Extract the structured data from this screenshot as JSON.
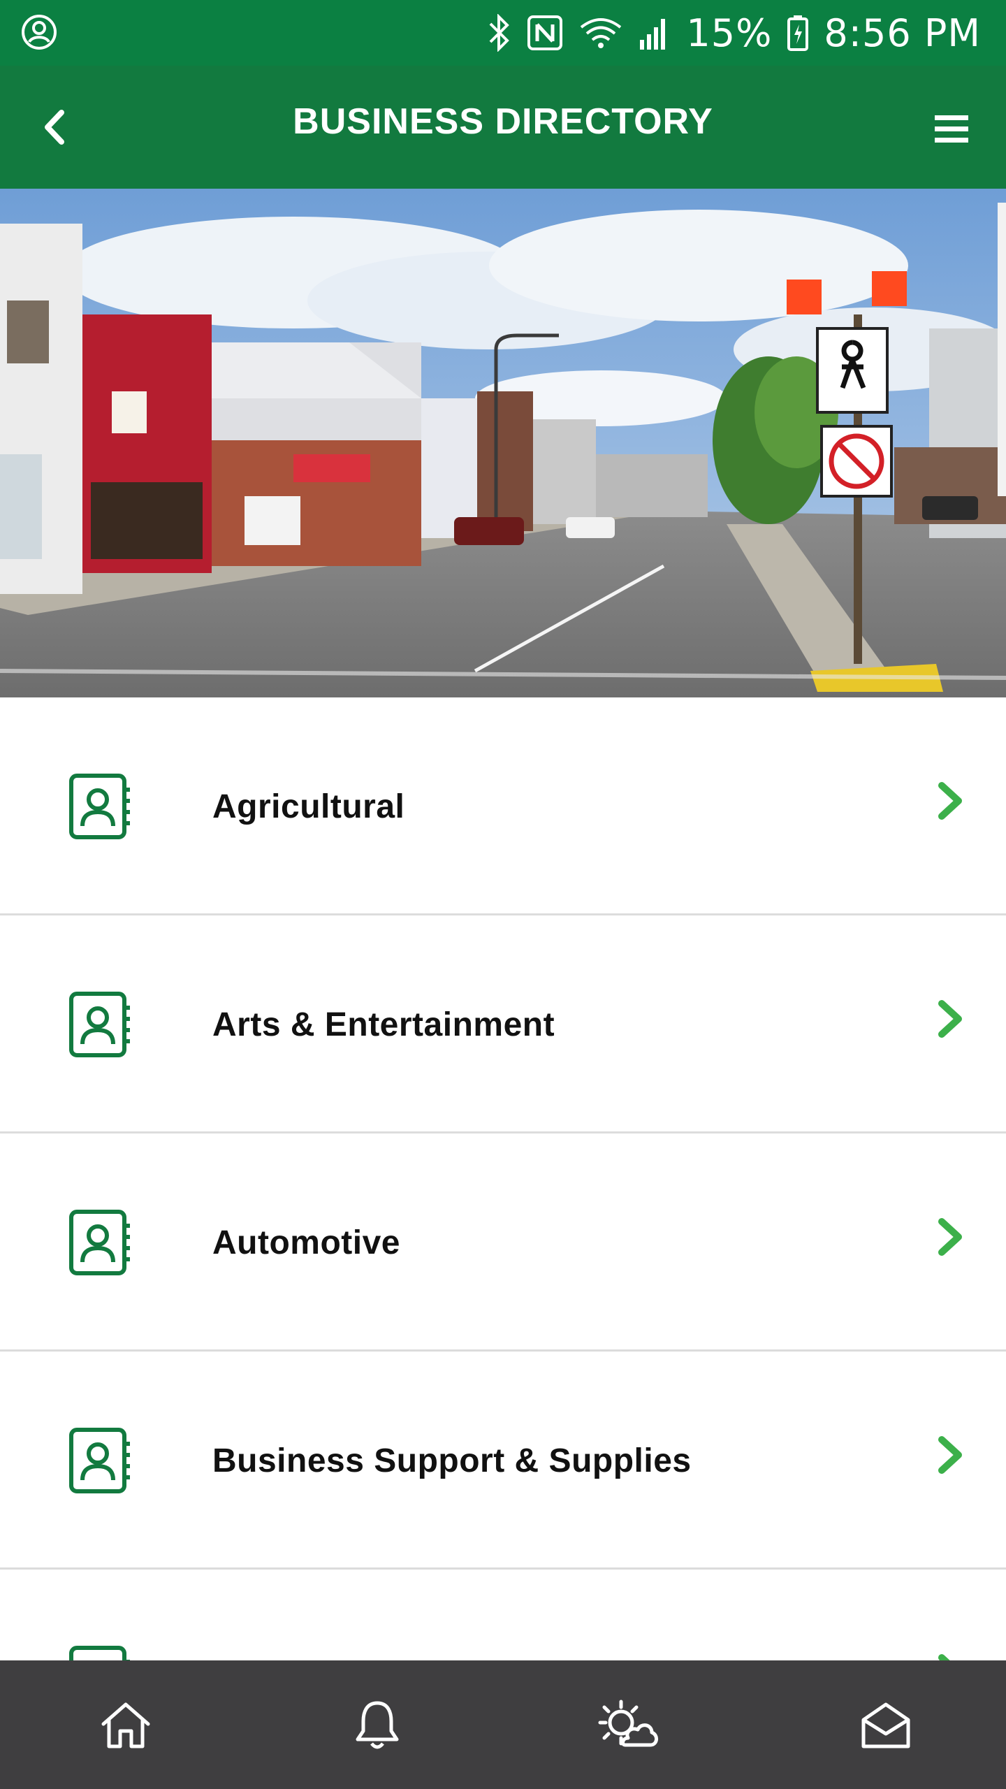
{
  "status_bar": {
    "battery_percent": "15%",
    "time": "8:56 PM",
    "left_icon": "account-circle-icon",
    "right_icons": [
      "bluetooth-icon",
      "nfc-icon",
      "wifi-icon",
      "signal-icon",
      "battery-icon"
    ]
  },
  "app_bar": {
    "title": "BUSINESS DIRECTORY",
    "back_icon": "chevron-left-icon",
    "menu_icon": "hamburger-menu-icon"
  },
  "hero": {
    "description_icon": "street-photo"
  },
  "categories": [
    {
      "label": "Agricultural"
    },
    {
      "label": "Arts & Entertainment"
    },
    {
      "label": "Automotive"
    },
    {
      "label": "Business Support & Supplies"
    },
    {
      "label": ""
    }
  ],
  "bottom_nav": {
    "tabs": [
      "home-icon",
      "bell-icon",
      "weather-icon",
      "mail-icon"
    ]
  },
  "colors": {
    "status_bar": "#0b8042",
    "app_bar": "#127a3f",
    "icon_green": "#127a3f",
    "chevron_green": "#3cb04a",
    "bottom_nav": "#3f3e40"
  }
}
